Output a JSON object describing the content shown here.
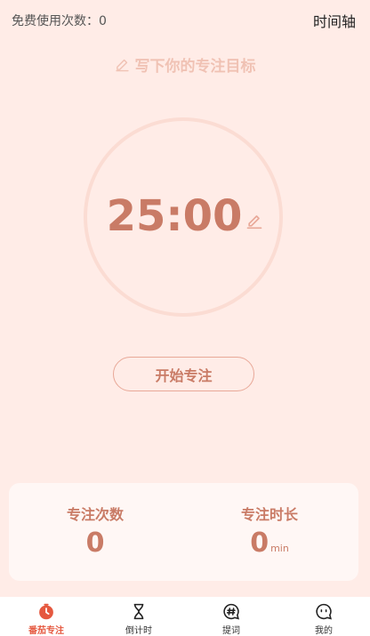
{
  "header": {
    "free_count_label": "免费使用次数：0",
    "timeline_label": "时间轴"
  },
  "goal": {
    "placeholder": "写下你的专注目标",
    "icon": "pencil-icon"
  },
  "timer": {
    "display": "25:00",
    "edit_icon": "pencil-icon"
  },
  "start_button": {
    "label": "开始专注"
  },
  "stats": {
    "count": {
      "label": "专注次数",
      "value": "0"
    },
    "duration": {
      "label": "专注时长",
      "value": "0",
      "unit": "min"
    }
  },
  "tabbar": {
    "tabs": [
      {
        "label": "番茄专注",
        "icon": "tomato-timer-icon",
        "active": true
      },
      {
        "label": "倒计时",
        "icon": "hourglass-icon",
        "active": false
      },
      {
        "label": "提词",
        "icon": "hashtag-bubble-icon",
        "active": false
      },
      {
        "label": "我的",
        "icon": "face-bubble-icon",
        "active": false
      }
    ]
  },
  "colors": {
    "background": "#ffece7",
    "accent": "#c97b66",
    "active_tab": "#e5583f",
    "ring": "#fbdcd3"
  }
}
